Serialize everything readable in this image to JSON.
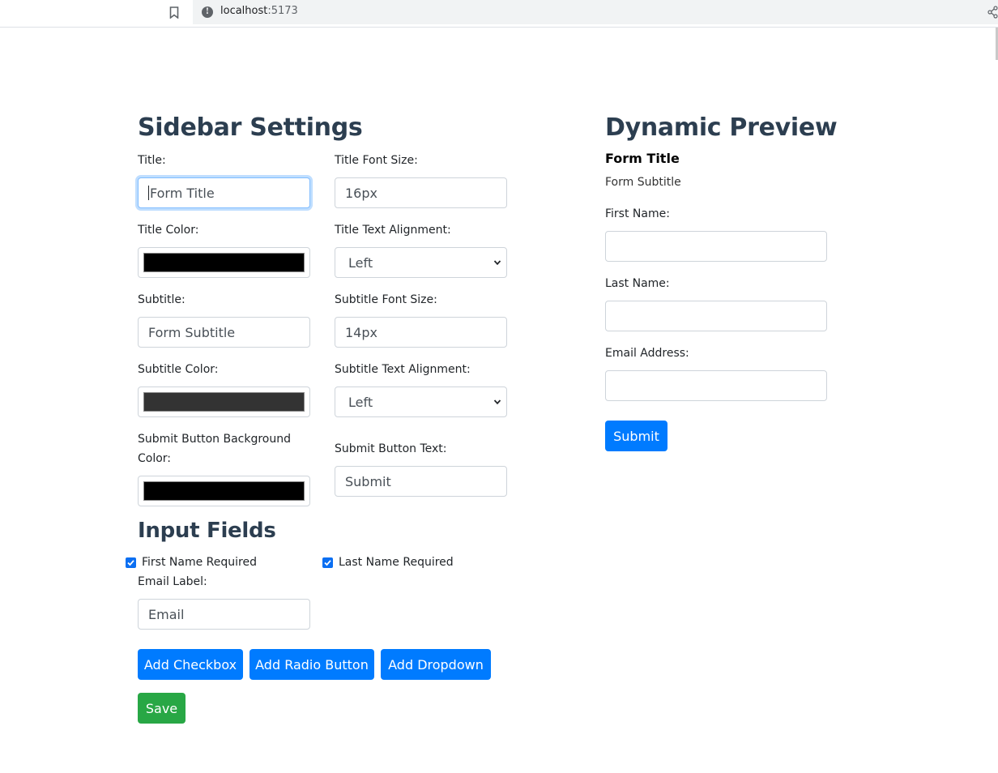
{
  "browser": {
    "url_host": "localhost",
    "url_port": ":5173"
  },
  "settings": {
    "heading": "Sidebar Settings",
    "title_label": "Title:",
    "title_value": "Form Title",
    "title_font_size_label": "Title Font Size:",
    "title_font_size_value": "16px",
    "title_color_label": "Title Color:",
    "title_color": "#000000",
    "title_align_label": "Title Text Alignment:",
    "title_align_value": "Left",
    "subtitle_label": "Subtitle:",
    "subtitle_value": "Form Subtitle",
    "subtitle_font_size_label": "Subtitle Font Size:",
    "subtitle_font_size_value": "14px",
    "subtitle_color_label": "Subtitle Color:",
    "subtitle_color": "#333333",
    "subtitle_align_label": "Subtitle Text Alignment:",
    "subtitle_align_value": "Left",
    "submit_bg_label": "Submit Button Background Color:",
    "submit_bg_color": "#000000",
    "submit_text_label": "Submit Button Text:",
    "submit_text_value": "Submit"
  },
  "input_fields": {
    "heading": "Input Fields",
    "first_name_required": "First Name Required",
    "last_name_required": "Last Name Required",
    "email_label_label": "Email Label:",
    "email_label_value": "Email",
    "add_checkbox": "Add Checkbox",
    "add_radio": "Add Radio Button",
    "add_dropdown": "Add Dropdown",
    "save": "Save"
  },
  "preview": {
    "heading": "Dynamic Preview",
    "form_title": "Form Title",
    "form_subtitle": "Form Subtitle",
    "first_name_label": "First Name:",
    "last_name_label": "Last Name:",
    "email_label": "Email Address:",
    "submit": "Submit"
  },
  "colors": {
    "primary": "#007bff",
    "success": "#28a745",
    "heading": "#2c3e50"
  }
}
